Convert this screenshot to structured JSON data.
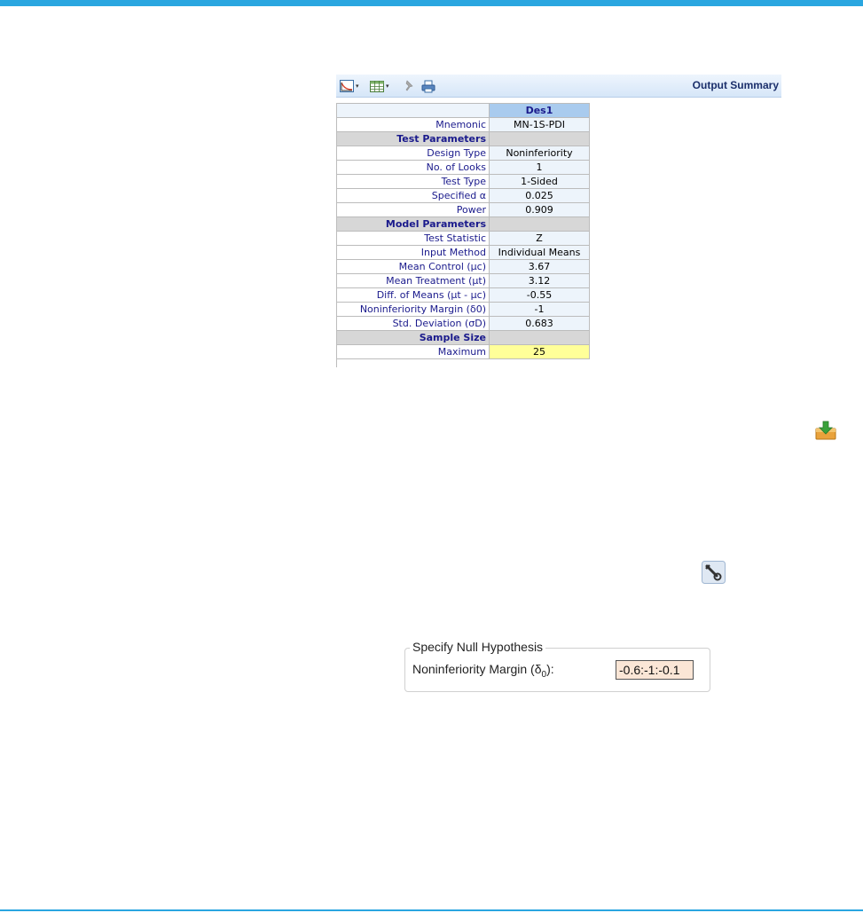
{
  "toolbar": {
    "title": "Output Summary",
    "buttons": [
      {
        "name": "chart-icon",
        "caret": "▾"
      },
      {
        "name": "table-icon",
        "caret": "▾"
      },
      {
        "name": "pin-icon"
      },
      {
        "name": "print-icon"
      }
    ]
  },
  "table": {
    "column_header": "Des1",
    "rows": [
      {
        "label": "Mnemonic",
        "value": "MN-1S-PDI"
      },
      {
        "section": "Test Parameters"
      },
      {
        "label": "Design Type",
        "value": "Noninferiority"
      },
      {
        "label": "No. of Looks",
        "value": "1"
      },
      {
        "label": "Test Type",
        "value": "1-Sided"
      },
      {
        "label": "Specified α",
        "value": "0.025"
      },
      {
        "label": "Power",
        "value": "0.909"
      },
      {
        "section": "Model Parameters"
      },
      {
        "label": "Test Statistic",
        "value": "Z"
      },
      {
        "label": "Input Method",
        "value": "Individual Means"
      },
      {
        "label": "Mean Control (µc)",
        "value": "3.67"
      },
      {
        "label": "Mean Treatment (µt)",
        "value": "3.12"
      },
      {
        "label": "Diff. of Means (µt - µc)",
        "value": "-0.55"
      },
      {
        "label": "Noninferiority Margin (δ0)",
        "value": "-1"
      },
      {
        "label": "Std. Deviation (σD)",
        "value": "0.683"
      },
      {
        "section": "Sample Size"
      },
      {
        "label": "Maximum",
        "value": "25",
        "highlight": true
      }
    ]
  },
  "icons": {
    "export": "export-icon",
    "wrench": "wrench-icon"
  },
  "null_hypothesis": {
    "legend": "Specify Null Hypothesis",
    "label_prefix": "Noninferiority Margin (δ",
    "label_sub": "0",
    "label_suffix": "):",
    "value": "-0.6:-1:-0.1"
  },
  "colors": {
    "accent_bar": "#2aa6e0",
    "column_header": "#a9cbee",
    "highlight": "#ffff99",
    "input_bg": "#fbe6d6"
  }
}
